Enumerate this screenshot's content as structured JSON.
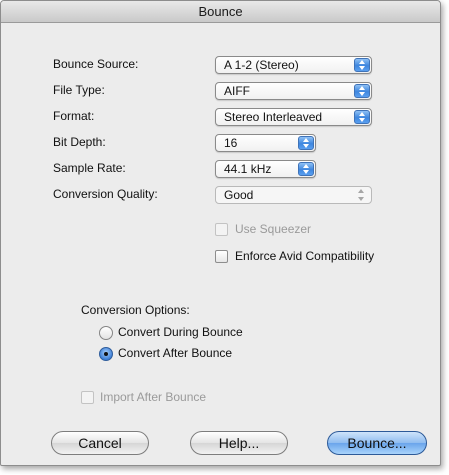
{
  "window": {
    "title": "Bounce"
  },
  "fields": {
    "bounce_source": {
      "label": "Bounce Source:",
      "value": "A 1-2 (Stereo)"
    },
    "file_type": {
      "label": "File Type:",
      "value": "AIFF"
    },
    "format": {
      "label": "Format:",
      "value": "Stereo Interleaved"
    },
    "bit_depth": {
      "label": "Bit Depth:",
      "value": "16"
    },
    "sample_rate": {
      "label": "Sample Rate:",
      "value": "44.1 kHz"
    },
    "conversion_quality": {
      "label": "Conversion Quality:",
      "value": "Good",
      "enabled": false
    }
  },
  "checkboxes": {
    "use_squeezer": {
      "label": "Use Squeezer",
      "checked": false,
      "enabled": false
    },
    "enforce_avid": {
      "label": "Enforce Avid Compatibility",
      "checked": false,
      "enabled": true
    },
    "import_after": {
      "label": "Import After Bounce",
      "checked": false,
      "enabled": false
    }
  },
  "conversion_options": {
    "heading": "Conversion Options:",
    "options": [
      {
        "label": "Convert During Bounce",
        "selected": false
      },
      {
        "label": "Convert After Bounce",
        "selected": true
      }
    ]
  },
  "buttons": {
    "cancel": "Cancel",
    "help": "Help...",
    "bounce": "Bounce..."
  },
  "colors": {
    "accent": "#3e86de",
    "window_bg": "#ececec",
    "disabled_text": "#9a9a9a"
  }
}
